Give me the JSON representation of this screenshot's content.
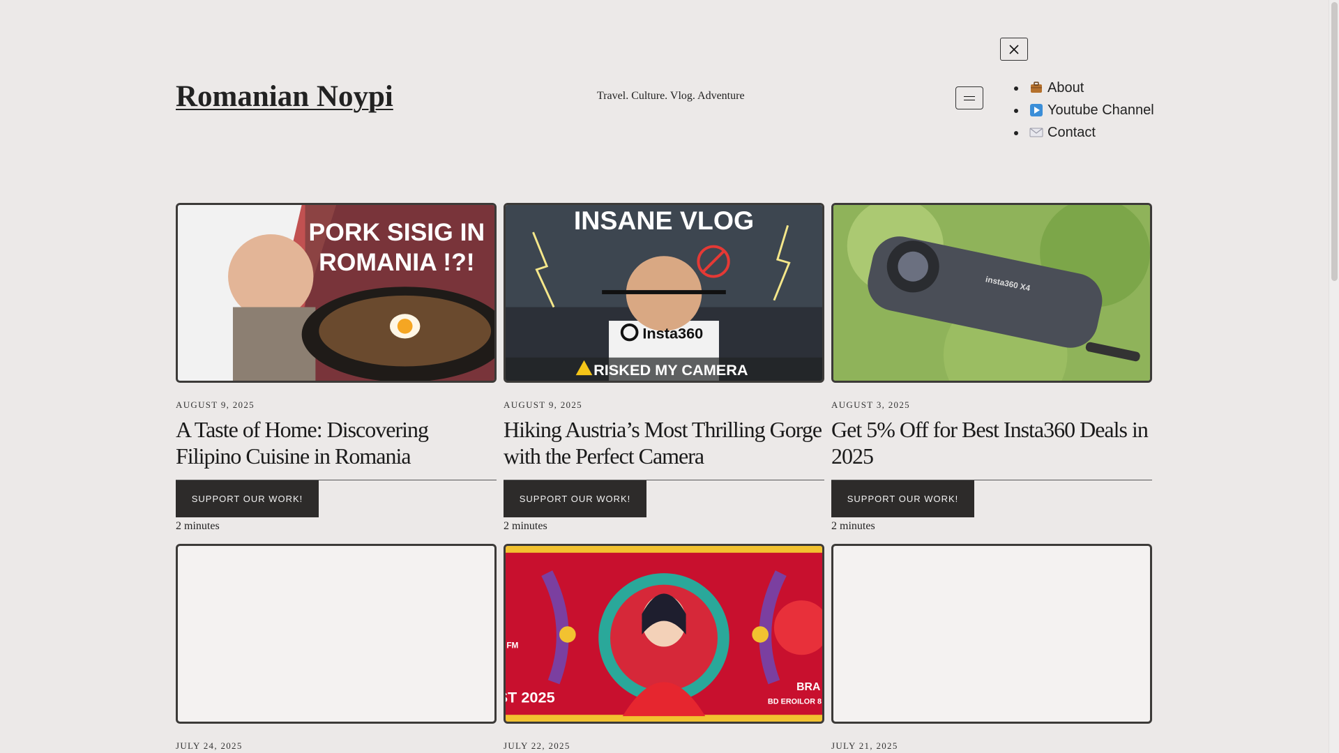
{
  "site": {
    "title": "Romanian Noypi",
    "tagline": "Travel. Culture. Vlog. Adventure"
  },
  "nav": {
    "items": [
      {
        "label": "About",
        "icon": "briefcase-icon"
      },
      {
        "label": "Youtube Channel",
        "icon": "play-button-icon"
      },
      {
        "label": "Contact",
        "icon": "envelope-icon"
      }
    ]
  },
  "posts": [
    {
      "date": "August 9, 2025",
      "title": "A Taste of Home: Discovering Filipino Cuisine in Romania",
      "support_label": "SUPPORT OUR WORK!",
      "read_time": "2 minutes",
      "thumb_text": [
        "PORK SISIG IN",
        "ROMANIA !?!"
      ]
    },
    {
      "date": "August 9, 2025",
      "title": "Hiking Austria’s Most Thrilling Gorge with the Perfect Camera",
      "support_label": "SUPPORT OUR WORK!",
      "read_time": "2 minutes",
      "thumb_text": [
        "INSANE VLOG",
        "Insta360",
        "RISKED MY CAMERA"
      ]
    },
    {
      "date": "August 3, 2025",
      "title": "Get 5% Off for Best Insta360 Deals in 2025",
      "support_label": "SUPPORT OUR WORK!",
      "read_time": "2 minutes",
      "thumb_text": [
        "insta360 X4"
      ]
    },
    {
      "date": "July 24, 2025"
    },
    {
      "date": "July 22, 2025",
      "thumb_text": [
        "ST 2025",
        "BRA",
        "BD EROILOR 8",
        "FM"
      ]
    },
    {
      "date": "July 21, 2025"
    }
  ],
  "colors": {
    "background": "#ece9e8",
    "button": "#2d2b2a",
    "border": "#3c3a38"
  }
}
